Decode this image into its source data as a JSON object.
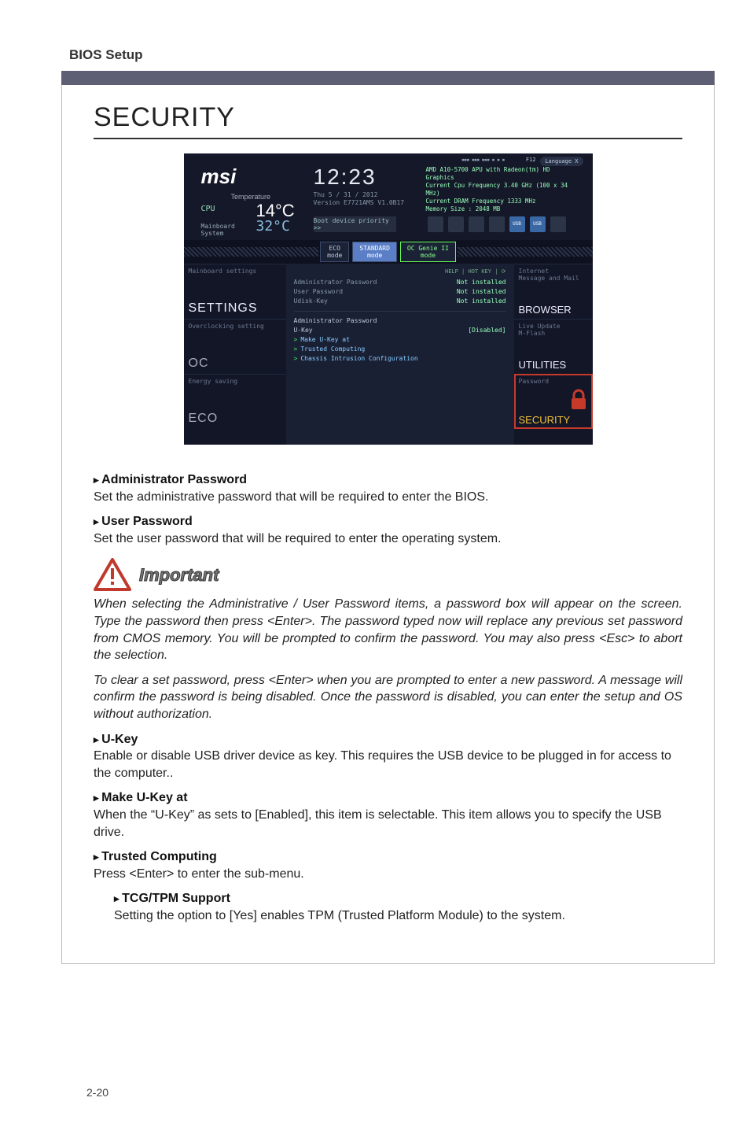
{
  "header": {
    "bios_setup": "BIOS Setup"
  },
  "title": "SECURITY",
  "shot": {
    "logo": "msi",
    "temperature_label": "Temperature",
    "cpu_label": "CPU",
    "cpu_temp": "14°C",
    "sys_label": "Mainboard\nSystem",
    "sys_temp": "32°C",
    "clock": "12:23",
    "date": "Thu  5 / 31 / 2012",
    "version": "Version E7721AMS V1.0B17",
    "boot_priority": "Boot device priority  >>",
    "cpu_info": "AMD A10-5700 APU with Radeon(tm) HD Graphics\nCurrent Cpu Frequency 3.40 GHz (100 x 34 MHz)\nCurrent DRAM Frequency 1333 MHz\nMemory Size : 2048 MB",
    "f12": "F12",
    "language": "Language  X",
    "icon_strip": "▪▪▪ ▪▪▪ ▪▪▪ ▪ ▪ ▪",
    "usb": "USB",
    "eco_tab": "ECO\nmode",
    "std_tab": "STANDARD\nmode",
    "ocgenie_tab": "OC Genie II\nmode",
    "left_nav": [
      {
        "sub": "Mainboard settings",
        "big": "SETTINGS"
      },
      {
        "sub": "Overclocking setting",
        "big": "OC"
      },
      {
        "sub": "Energy saving",
        "big": "ECO"
      }
    ],
    "right_nav": [
      {
        "sub": "Internet\nMessage and Mail",
        "big": "BROWSER"
      },
      {
        "sub": "Live Update\nM-Flash",
        "big": "UTILITIES"
      },
      {
        "sub": "Password",
        "big": "SECURITY"
      }
    ],
    "help_line": "HELP  |  HOT KEY  |  ⟳",
    "rows_top": [
      {
        "lbl": "Administrator Password",
        "val": "Not installed"
      },
      {
        "lbl": "User  Password",
        "val": "Not installed"
      },
      {
        "lbl": "Udisk-Key",
        "val": "Not installed"
      }
    ],
    "rows_mid": [
      {
        "lbl": "Administrator Password",
        "val": ""
      },
      {
        "lbl": "U-Key",
        "val": "[Disabled]"
      }
    ],
    "rows_sub": [
      {
        "lbl": "Make U-Key at"
      },
      {
        "lbl": "Trusted Computing"
      },
      {
        "lbl": "Chassis Intrusion Configuration"
      }
    ]
  },
  "doc": {
    "admin_head": "Administrator Password",
    "admin_body": "Set the administrative password that will be required to enter the BIOS.",
    "user_head": "User Password",
    "user_body": "Set the user password that will be required to enter the operating system.",
    "important": "Important",
    "para1": "When selecting the Administrative / User Password items, a password box will appear on the screen. Type the password then press <Enter>. The password typed now will replace any previous set password from CMOS memory. You will be prompted to confirm the password. You may also press <Esc> to abort the selection.",
    "para2": "To clear a set password, press <Enter> when you are prompted to enter a new password. A message will confirm the password is being disabled. Once the password is disabled, you can enter the setup and OS without authorization.",
    "ukey_head": "U-Key",
    "ukey_body": "Enable or disable USB driver device as key. This requires the USB device to be plugged in for access to the computer..",
    "make_head": "Make U-Key at",
    "make_body": "When the “U-Key” as sets to [Enabled], this item is selectable. This item allows you to specify the USB drive.",
    "trusted_head": "Trusted Computing",
    "trusted_body": "Press <Enter> to enter the sub-menu.",
    "tcg_head": "TCG/TPM Support",
    "tcg_body": "Setting the option to [Yes] enables TPM (Trusted Platform Module) to the system."
  },
  "pagenum": "2-20"
}
